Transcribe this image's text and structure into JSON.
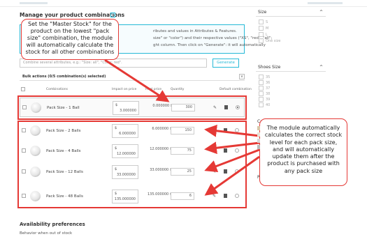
{
  "section_title": "Manage your product combinations",
  "info_lines": [
    "ributes and values in Attributes & Features.",
    "size\" or \"color\") and their respective values (\"XS\", \"red\", \"all\";",
    "ght column. Then click on \"Generate\": it will automatically"
  ],
  "combination_input_placeholder": "Combine several attributes, e.g.: \"Size: all\", \"Color: red\".",
  "generate_button": "Generate",
  "bulk_actions": "Bulk actions (0/5 combination(s) selected)",
  "table_headers": {
    "combinations": "Combinations",
    "impact": "Impact on price",
    "final": "Final price",
    "quantity": "Quantity",
    "default": "Default combination"
  },
  "rows": [
    {
      "name": "Pack Size - 1 Ball",
      "currency": "$",
      "impact": "3.000000",
      "final": "0.000000 $",
      "quantity": "300",
      "default": true
    },
    {
      "name": "Pack Size - 2 Balls",
      "currency": "$",
      "impact": "6.000000",
      "final": "6.000000 $",
      "quantity": "150",
      "default": false
    },
    {
      "name": "Pack Size - 4 Balls",
      "currency": "$",
      "impact": "12.000000",
      "final": "12.000000 $",
      "quantity": "75",
      "default": false
    },
    {
      "name": "Pack Size - 12 Balls",
      "currency": "$",
      "impact": "33.000000",
      "final": "33.000000 $",
      "quantity": "25",
      "default": false
    },
    {
      "name": "Pack Size - 48 Balls",
      "currency": "$",
      "impact": "135.000000",
      "final": "135.000000 $",
      "quantity": "6",
      "default": false
    }
  ],
  "availability_title": "Availability preferences",
  "behavior_label": "Behavior when out of stock",
  "sidebar": {
    "size_title": "Size",
    "size_items": [
      "S",
      "M",
      "L",
      "One size"
    ],
    "shoes_title": "Shoes Size",
    "shoes_items": [
      "35",
      "36",
      "37",
      "38",
      "39",
      "40"
    ],
    "partial_label_1": "Co",
    "partial_label_2": "Pa"
  },
  "callout_top": "Set the \"Master Stock\" for the product on the lowest \"pack size\" combination, the module will automatically calculate the stock for all other combinations",
  "callout_right": "The module automatically calculates the correct stock level for each pack size, and will automatically update them after the product is purchased with any pack size",
  "colors": {
    "accent": "#25b9d7",
    "annotation": "#e53935"
  }
}
